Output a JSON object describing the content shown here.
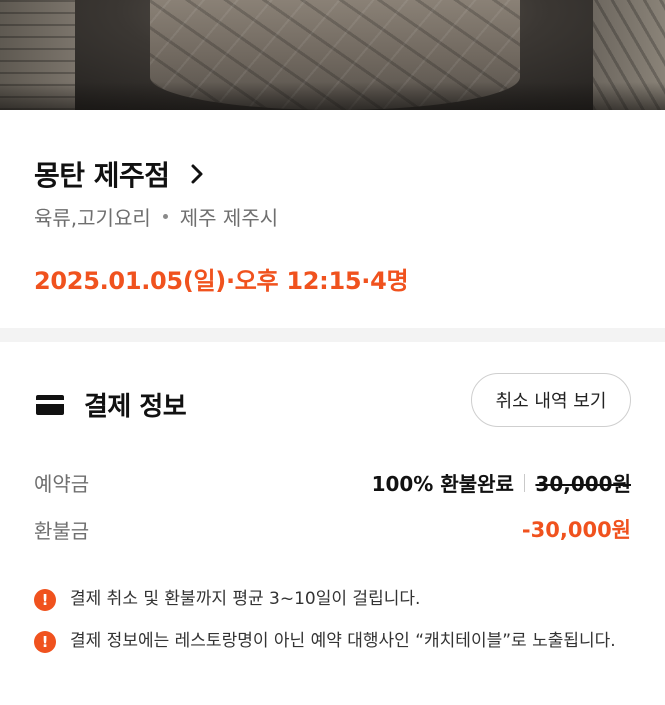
{
  "restaurant": {
    "name": "몽탄 제주점",
    "category": "육류,고기요리",
    "location": "제주 제주시",
    "reservation": "2025.01.05(일)·오후 12:15·4명"
  },
  "payment": {
    "title": "결제 정보",
    "history_button": "취소 내역 보기",
    "deposit": {
      "label": "예약금",
      "status": "100% 환불완료",
      "amount": "30,000원"
    },
    "refund": {
      "label": "환불금",
      "amount": "-30,000원"
    },
    "notices": [
      "결제 취소 및 환불까지 평균 3~10일이 걸립니다.",
      "결제 정보에는 레스토랑명이 아닌 예약 대행사인 “캐치테이블”로 노출됩니다."
    ]
  },
  "colors": {
    "accent": "#f0521e",
    "divider": "#f3f3f3"
  },
  "icons": [
    "chevron-right-icon",
    "card-icon",
    "info-icon"
  ]
}
